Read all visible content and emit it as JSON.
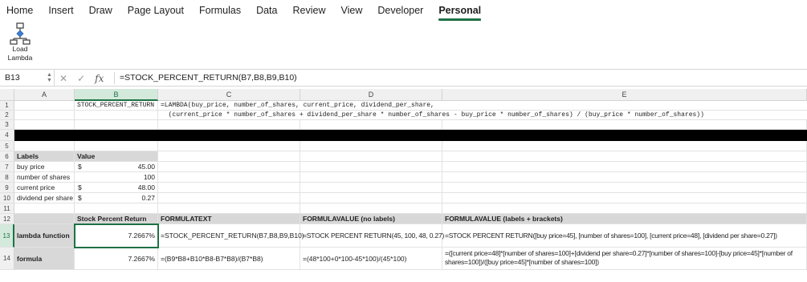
{
  "ribbon": {
    "tabs": [
      "Home",
      "Insert",
      "Draw",
      "Page Layout",
      "Formulas",
      "Data",
      "Review",
      "View",
      "Developer",
      "Personal"
    ],
    "active_tab": "Personal",
    "load_lambda_label_1": "Load",
    "load_lambda_label_2": "Lambda"
  },
  "formula_bar": {
    "name_box": "B13",
    "fx": "fx",
    "formula": "=STOCK_PERCENT_RETURN(B7,B8,B9,B10)"
  },
  "columns": [
    "A",
    "B",
    "C",
    "D",
    "E"
  ],
  "selected_column": "B",
  "rows": [
    "1",
    "2",
    "3",
    "4",
    "5",
    "6",
    "7",
    "8",
    "9",
    "10",
    "11",
    "12",
    "13",
    "14"
  ],
  "selected_row": "13",
  "cells": {
    "B1": "STOCK_PERCENT_RETURN",
    "C1": "=LAMBDA(buy_price, number_of_shares, current_price, dividend_per_share,",
    "C2": "  (current_price * number_of_shares + dividend_per_share * number_of_shares - buy_price * number_of_shares) / (buy_price * number_of_shares))",
    "A6": "Labels",
    "B6": "Value",
    "A7": "buy price",
    "B7_cur": "$",
    "B7": "45.00",
    "A8": "number of shares",
    "B8": "100",
    "A9": "current price",
    "B9_cur": "$",
    "B9": "48.00",
    "A10": "dividend per share",
    "B10_cur": "$",
    "B10": "0.27",
    "B12": "Stock Percent Return",
    "C12": "FORMULATEXT",
    "D12": "FORMULAVALUE (no labels)",
    "E12": "FORMULAVALUE (labels + brackets)",
    "A13": "lambda function",
    "B13": "7.2667%",
    "C13": "=STOCK_PERCENT_RETURN(B7,B8,B9,B10)",
    "D13": "=STOCK PERCENT RETURN(45, 100, 48, 0.27)",
    "E13": "=STOCK PERCENT RETURN([buy price=45], [number of shares=100], [current price=48], [dividend per share=0.27])",
    "A14": "formula",
    "B14": "7.2667%",
    "C14": "=(B9*B8+B10*B8-B7*B8)/(B7*B8)",
    "D14": "=(48*100+0*100-45*100)/(45*100)",
    "E14": "=([current price=48]*[number of shares=100]+[dividend per share=0.27]*[number of shares=100]-[buy price=45]*[number of shares=100])/([buy price=45]*[number of shares=100])"
  }
}
